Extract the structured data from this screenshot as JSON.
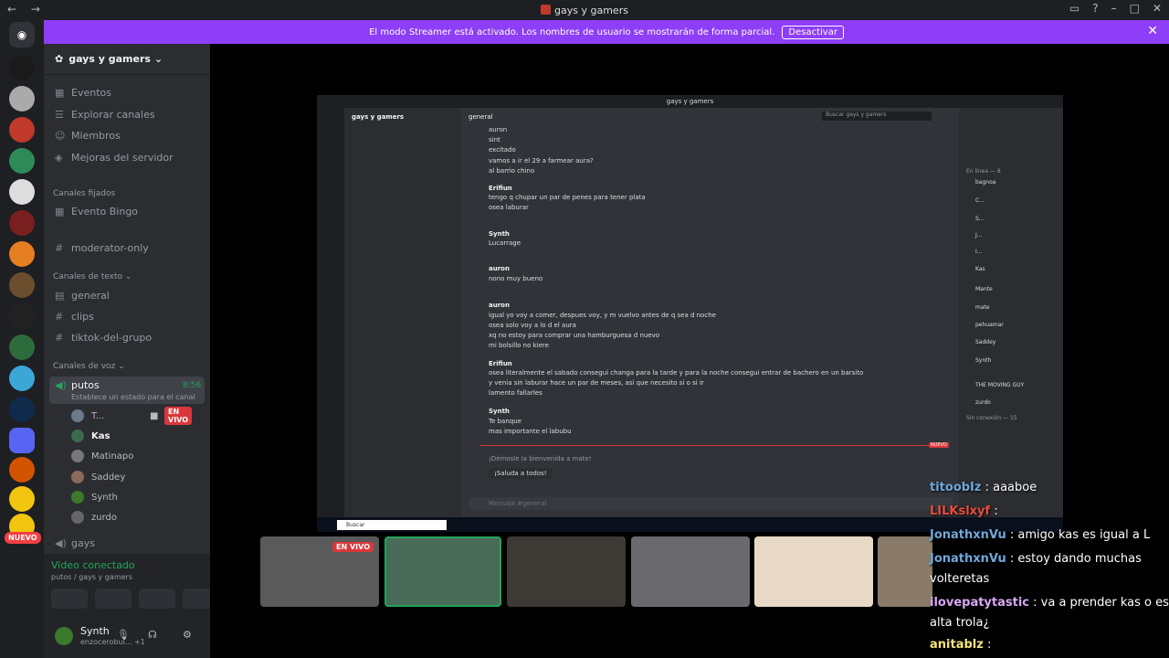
{
  "window": {
    "title": "gays y gamers"
  },
  "banner": {
    "text": "El modo Streamer está activado. Los nombres de usuario se mostrarán de forma parcial.",
    "button": "Desactivar"
  },
  "server": {
    "name": "gays y gamers"
  },
  "nav_items": [
    {
      "label": "Eventos"
    },
    {
      "label": "Explorar canales"
    },
    {
      "label": "Miembros"
    },
    {
      "label": "Mejoras del servidor"
    }
  ],
  "pinned": {
    "title": "Canales fijados",
    "item": "Evento Bingo"
  },
  "mod_channel": "moderator-only",
  "text_category": "Canales de texto",
  "text_channels": [
    "general",
    "clips",
    "tiktok-del-grupo"
  ],
  "voice_category": "Canales de voz",
  "voice_channel": {
    "name": "putos",
    "timer": "8:56",
    "status": "Establece un estado para el canal"
  },
  "voice_users": [
    {
      "name": "T...",
      "live": "EN VIVO"
    },
    {
      "name": "Kas"
    },
    {
      "name": "Matinapo"
    },
    {
      "name": "Saddey"
    },
    {
      "name": "Synth"
    },
    {
      "name": "zurdo"
    }
  ],
  "other_voice": "gays",
  "nuevo_badge": "NUEVO",
  "voice_panel": {
    "status": "Video conectado",
    "sub": "putos / gays y gamers"
  },
  "user_panel": {
    "name": "Synth",
    "status": "enzocerobul...",
    "extra": "+1"
  },
  "stream": {
    "title": "gays y gamers",
    "channel": "general",
    "server": "gays y gamers",
    "search": "Buscar gays y gamers",
    "messages": [
      {
        "name": "",
        "text": "auron"
      },
      {
        "name": "",
        "text": "sint"
      },
      {
        "name": "",
        "text": "excitado"
      },
      {
        "name": "",
        "text": "vamos a ir el 29 a farmear aura?"
      },
      {
        "name": "",
        "text": "al barrio chino"
      },
      {
        "name": "Erifiun",
        "text": "tengo q chupar un par de penes para tener plata"
      },
      {
        "name": "",
        "text": "osea laburar"
      },
      {
        "name": "Synth",
        "text": "Lucarrage"
      },
      {
        "name": "auron",
        "text": "nono muy bueno"
      },
      {
        "name": "auron",
        "text": "igual yo voy a comer, despues voy, y m vuelvo antes de q sea d noche"
      },
      {
        "name": "",
        "text": "osea solo voy a lo d el aura"
      },
      {
        "name": "",
        "text": "xq no estoy para comprar una hamburguesa d nuevo"
      },
      {
        "name": "",
        "text": "mi bolsillo no kiere"
      },
      {
        "name": "Erifiun",
        "text": "osea literalmente el sabado consegui changa para la tarde y para la noche consegui entrar de bachero en un barsito"
      },
      {
        "name": "",
        "text": "y venia sin laburar hace un par de meses, asi que necesito si o si ir"
      },
      {
        "name": "",
        "text": "lamento fallarles"
      },
      {
        "name": "Synth",
        "text": "Te banque"
      },
      {
        "name": "",
        "text": "mas importante el labubu"
      },
      {
        "name": "",
        "text": "¡Saluda a todos!"
      }
    ],
    "welcome": "¡Démosle la bienvenida a mate!",
    "input": "Mensaje #general",
    "taskbar_search": "Buscar",
    "new_badge": "NUEVO",
    "members_title": "En línea — 8",
    "members": [
      "bagnoa",
      "C...",
      "S...",
      "J...",
      "I...",
      "Kas",
      "Mante",
      "mate",
      "pehuamar",
      "Saddey",
      "Synth",
      "THE MOVING GUY",
      "zurdo"
    ],
    "offline": "Sin conexión — 15"
  },
  "thumb_live": "EN VIVO",
  "chat_overlay": [
    {
      "user": "titoobIz",
      "msg": " : aaaboe"
    },
    {
      "user": "LILKslxyf",
      "msg": " :"
    },
    {
      "user": "JonathxnVu",
      "msg": " : amigo kas es igual a L"
    },
    {
      "user": "JonathxnVu",
      "msg": " : estoy dando muchas"
    },
    {
      "user": "",
      "msg": "volteretas"
    },
    {
      "user": "ilovepatytastic",
      "msg": " : va a prender kas o es"
    },
    {
      "user": "",
      "msg": "alta trola¿"
    },
    {
      "user": "anitablz",
      "msg": " :"
    }
  ],
  "colors": {
    "accent": "#8e3ef6",
    "live": "#da373c",
    "online": "#23a55a"
  }
}
